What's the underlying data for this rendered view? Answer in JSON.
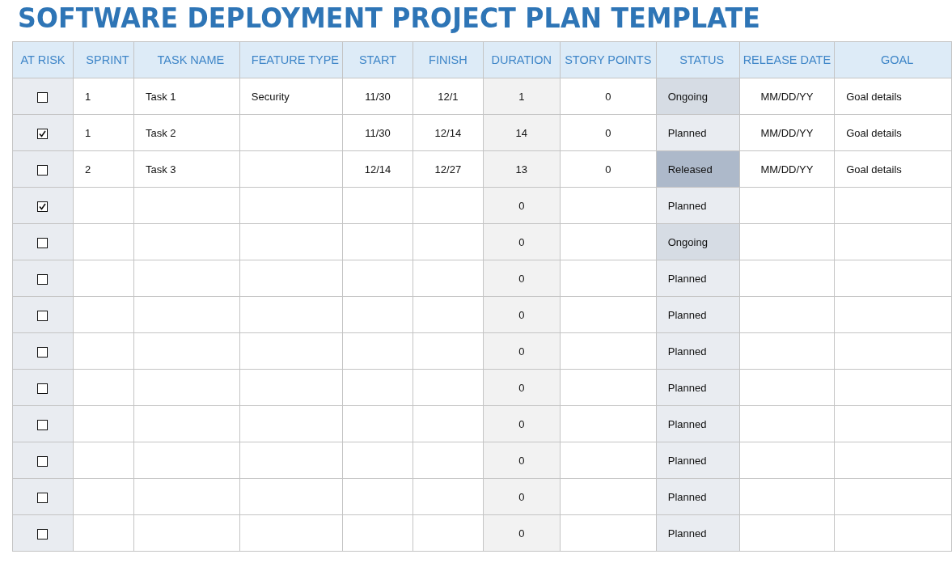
{
  "title": "SOFTWARE DEPLOYMENT PROJECT PLAN TEMPLATE",
  "table": {
    "columns": [
      {
        "label": "AT RISK"
      },
      {
        "label": "SPRINT"
      },
      {
        "label": "TASK NAME"
      },
      {
        "label": "FEATURE TYPE"
      },
      {
        "label": "START"
      },
      {
        "label": "FINISH"
      },
      {
        "label": "DURATION"
      },
      {
        "label": "STORY POINTS"
      },
      {
        "label": "STATUS"
      },
      {
        "label": "RELEASE DATE"
      },
      {
        "label": "GOAL"
      }
    ],
    "rows": [
      {
        "at_risk": false,
        "sprint": "1",
        "task_name": "Task 1",
        "feature_type": "Security",
        "start": "11/30",
        "finish": "12/1",
        "duration": "1",
        "story_points": "0",
        "status": {
          "label": "Ongoing",
          "kind": "ongoing"
        },
        "release_date": "MM/DD/YY",
        "goal": "Goal details"
      },
      {
        "at_risk": true,
        "sprint": "1",
        "task_name": "Task 2",
        "start": "11/30",
        "finish": "12/14",
        "duration": "14",
        "story_points": "0",
        "status": {
          "label": "Planned",
          "kind": "planned"
        },
        "release_date": "MM/DD/YY",
        "goal": "Goal details"
      },
      {
        "at_risk": false,
        "sprint": "2",
        "task_name": "Task 3",
        "start": "12/14",
        "finish": "12/27",
        "duration": "13",
        "story_points": "0",
        "status": {
          "label": "Released",
          "kind": "released"
        },
        "release_date": "MM/DD/YY",
        "goal": "Goal details"
      },
      {
        "at_risk": true,
        "duration": "0",
        "status": {
          "label": "Planned",
          "kind": "planned"
        }
      },
      {
        "at_risk": false,
        "duration": "0",
        "status": {
          "label": "Ongoing",
          "kind": "ongoing"
        }
      },
      {
        "at_risk": false,
        "duration": "0",
        "status": {
          "label": "Planned",
          "kind": "planned"
        }
      },
      {
        "at_risk": false,
        "duration": "0",
        "status": {
          "label": "Planned",
          "kind": "planned"
        }
      },
      {
        "at_risk": false,
        "duration": "0",
        "status": {
          "label": "Planned",
          "kind": "planned"
        }
      },
      {
        "at_risk": false,
        "duration": "0",
        "status": {
          "label": "Planned",
          "kind": "planned"
        }
      },
      {
        "at_risk": false,
        "duration": "0",
        "status": {
          "label": "Planned",
          "kind": "planned"
        }
      },
      {
        "at_risk": false,
        "duration": "0",
        "status": {
          "label": "Planned",
          "kind": "planned"
        }
      },
      {
        "at_risk": false,
        "duration": "0",
        "status": {
          "label": "Planned",
          "kind": "planned"
        }
      },
      {
        "at_risk": false,
        "duration": "0",
        "status": {
          "label": "Planned",
          "kind": "planned"
        }
      }
    ]
  }
}
